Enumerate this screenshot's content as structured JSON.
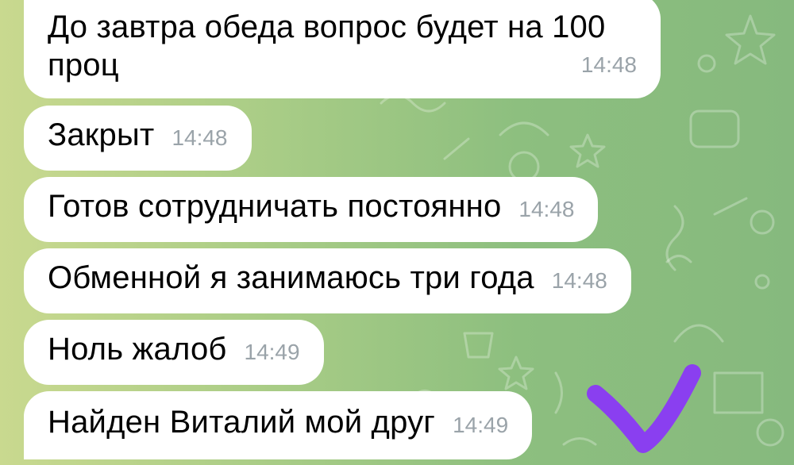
{
  "messages": [
    {
      "text_line1": "До завтра обеда вопрос будет на 100",
      "text_line2": "проц",
      "time": "14:48"
    },
    {
      "text": "Закрыт",
      "time": "14:48"
    },
    {
      "text": "Готов сотрудничать постоянно",
      "time": "14:48"
    },
    {
      "text": "Обменной я занимаюсь три года",
      "time": "14:48"
    },
    {
      "text": "Ноль жалоб",
      "time": "14:49"
    },
    {
      "text": "Найден Виталий мой друг",
      "time": "14:49"
    }
  ],
  "colors": {
    "bubble": "#ffffff",
    "timestamp": "#9aa3a9",
    "checkmark": "#8a3ff0",
    "wallpaper": "#9cc883"
  }
}
